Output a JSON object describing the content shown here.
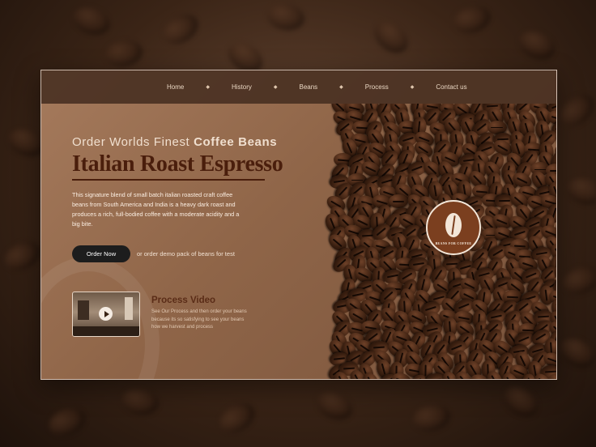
{
  "nav": {
    "items": [
      {
        "label": "Home"
      },
      {
        "label": "History"
      },
      {
        "label": "Beans"
      },
      {
        "label": "Process"
      },
      {
        "label": "Contact us"
      }
    ]
  },
  "hero": {
    "tagline_light": "Order Worlds Finest ",
    "tagline_bold": "Coffee Beans",
    "headline": "Italian Roast Espresso",
    "description": "This signature blend of small batch italian roasted craft coffee beans from South America and India is a heavy dark roast and produces a rich, full-bodied coffee with a moderate acidity and a big bite.",
    "order_button": "Order Now",
    "order_alt": "or order demo pack of beans for test"
  },
  "video": {
    "title": "Process Video",
    "description": "See Our Process and then order your beans because its so satisfying to see your beans how we harvest and process"
  },
  "badge": {
    "text": "BEANS FOR COFFEE"
  },
  "colors": {
    "accent": "#4a1e0c",
    "nav_bg": "#462e20",
    "button": "#1d1d1d"
  }
}
